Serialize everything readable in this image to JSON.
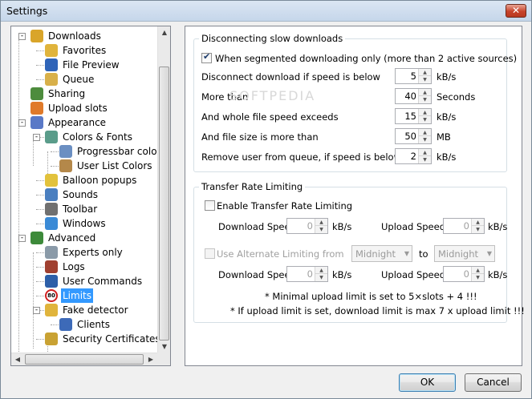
{
  "window": {
    "title": "Settings",
    "close": "✕"
  },
  "tree": {
    "items": [
      {
        "label": "Downloads",
        "color": "#d9a52a"
      },
      {
        "label": "Favorites",
        "color": "#e0b43c"
      },
      {
        "label": "File Preview",
        "color": "#2f64b8"
      },
      {
        "label": "Queue",
        "color": "#d8b04a"
      },
      {
        "label": "Sharing",
        "color": "#4d8c3d"
      },
      {
        "label": "Upload slots",
        "color": "#e07a2a"
      },
      {
        "label": "Appearance",
        "color": "#5a79c7"
      },
      {
        "label": "Colors & Fonts",
        "color": "#5a9c8a"
      },
      {
        "label": "Progressbar colors",
        "color": "#6b8fc2"
      },
      {
        "label": "User List Colors",
        "color": "#b4884a"
      },
      {
        "label": "Balloon popups",
        "color": "#e2c23c"
      },
      {
        "label": "Sounds",
        "color": "#4a7fc0"
      },
      {
        "label": "Toolbar",
        "color": "#707070"
      },
      {
        "label": "Windows",
        "color": "#3a8ad6"
      },
      {
        "label": "Advanced",
        "color": "#3d8a3a"
      },
      {
        "label": "Experts only",
        "color": "#8a9aa8"
      },
      {
        "label": "Logs",
        "color": "#a04030"
      },
      {
        "label": "User Commands",
        "color": "#2d5fa8"
      },
      {
        "label": "Limits",
        "color": "#d02020",
        "badge": "80"
      },
      {
        "label": "Fake detector",
        "color": "#e0b43c"
      },
      {
        "label": "Clients",
        "color": "#3d6ab8"
      },
      {
        "label": "Security Certificates",
        "color": "#c9a233"
      }
    ]
  },
  "slow": {
    "title": "Disconnecting slow downloads",
    "segmented_label": "When segmented downloading only (more than 2 active sources)",
    "rows": [
      {
        "label": "Disconnect download if speed is below",
        "value": "5",
        "unit": "kB/s"
      },
      {
        "label": "More than",
        "value": "40",
        "unit": "Seconds"
      },
      {
        "label": "And whole file speed exceeds",
        "value": "15",
        "unit": "kB/s"
      },
      {
        "label": "And file size is more than",
        "value": "50",
        "unit": "MB"
      },
      {
        "label": "Remove user from queue, if speed is below",
        "value": "2",
        "unit": "kB/s"
      }
    ]
  },
  "rate": {
    "title": "Transfer Rate Limiting",
    "enable_label": "Enable Transfer Rate Limiting",
    "download_label": "Download Speed",
    "upload_label": "Upload Speed",
    "download_value": "0",
    "upload_value": "0",
    "unit": "kB/s",
    "alt_label": "Use Alternate Limiting from",
    "alt_from": "Midnight",
    "alt_to_label": "to",
    "alt_to": "Midnight",
    "alt_download_value": "0",
    "alt_upload_value": "0",
    "note1": "* Minimal upload limit is set to 5×slots + 4 !!!",
    "note2": "* If upload limit is set, download limit is max 7 x upload limit !!!"
  },
  "buttons": {
    "ok": "OK",
    "cancel": "Cancel"
  },
  "watermark": "SOFTPEDIA"
}
